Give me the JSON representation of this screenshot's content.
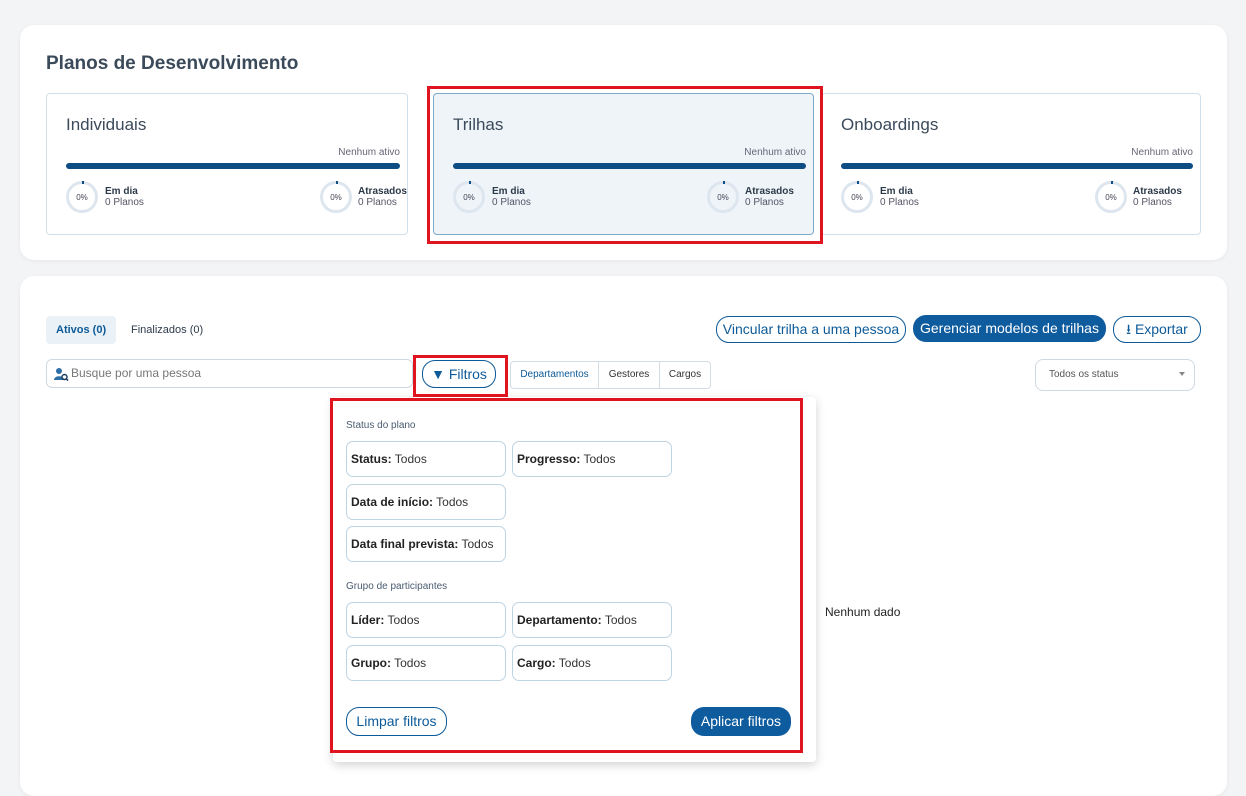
{
  "header": {
    "title": "Planos de Desenvolvimento"
  },
  "plans": [
    {
      "title": "Individuais",
      "status": "Nenhum ativo",
      "on_time_pct": "0%",
      "on_time_label": "Em dia",
      "on_time_count": "0 Planos",
      "late_pct": "0%",
      "late_label": "Atrasados",
      "late_count": "0 Planos"
    },
    {
      "title": "Trilhas",
      "status": "Nenhum ativo",
      "on_time_pct": "0%",
      "on_time_label": "Em dia",
      "on_time_count": "0 Planos",
      "late_pct": "0%",
      "late_label": "Atrasados",
      "late_count": "0 Planos"
    },
    {
      "title": "Onboardings",
      "status": "Nenhum ativo",
      "on_time_pct": "0%",
      "on_time_label": "Em dia",
      "on_time_count": "0 Planos",
      "late_pct": "0%",
      "late_label": "Atrasados",
      "late_count": "0 Planos"
    }
  ],
  "tabs": [
    {
      "label": "Ativos (0)"
    },
    {
      "label": "Finalizados (0)"
    }
  ],
  "actions": {
    "link_label": "Vincular trilha a uma pessoa",
    "manage_label": "Gerenciar modelos de trilhas",
    "export_label": "Exportar"
  },
  "search": {
    "placeholder": "Busque por uma pessoa"
  },
  "filters_label": "Filtros",
  "segments": [
    "Departamentos",
    "Gestores",
    "Cargos"
  ],
  "status_select": {
    "value": "Todos os status"
  },
  "empty_text": "Nenhum dado",
  "dropdown": {
    "section_status": "Status do plano",
    "status_chips": [
      {
        "key": "Status:",
        "value": "Todos"
      },
      {
        "key": "Progresso:",
        "value": "Todos"
      },
      {
        "key": "Data de início:",
        "value": "Todos"
      },
      {
        "key": "Data final prevista:",
        "value": "Todos"
      }
    ],
    "section_group": "Grupo de participantes",
    "group_chips": [
      {
        "key": "Líder:",
        "value": "Todos"
      },
      {
        "key": "Departamento:",
        "value": "Todos"
      },
      {
        "key": "Grupo:",
        "value": "Todos"
      },
      {
        "key": "Cargo:",
        "value": "Todos"
      }
    ],
    "clear_label": "Limpar filtros",
    "apply_label": "Aplicar filtros"
  },
  "colors": {
    "primary": "#0e5b9e",
    "bar": "#0d4d84",
    "highlight": "#e0141e"
  }
}
